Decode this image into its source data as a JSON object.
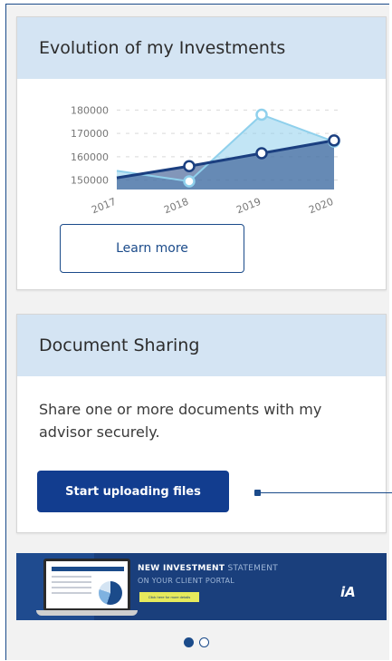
{
  "investments": {
    "title": "Evolution of my Investments",
    "learn_more_label": "Learn more"
  },
  "chart_data": {
    "type": "area",
    "categories": [
      "2017",
      "2018",
      "2019",
      "2020"
    ],
    "yticks": [
      "180000",
      "170000",
      "160000",
      "150000"
    ],
    "ylim": [
      146000,
      184000
    ],
    "grid": true,
    "series": [
      {
        "name": "",
        "values": [
          154000,
          149500,
          178000,
          166500
        ],
        "color": "#8fd0ec"
      },
      {
        "name": "",
        "values": [
          151000,
          156000,
          161500,
          167000
        ],
        "color": "#1b3f80"
      }
    ]
  },
  "documents": {
    "title": "Document Sharing",
    "description": "Share one or more documents with my advisor securely.",
    "upload_label": "Start uploading files"
  },
  "banner": {
    "title_bold": "NEW INVESTMENT",
    "title_light": " STATEMENT",
    "subtitle": "ON YOUR CLIENT PORTAL",
    "cta": "Click here for more details",
    "logo": "iA"
  },
  "carousel": {
    "pages": 2,
    "active": 0
  }
}
